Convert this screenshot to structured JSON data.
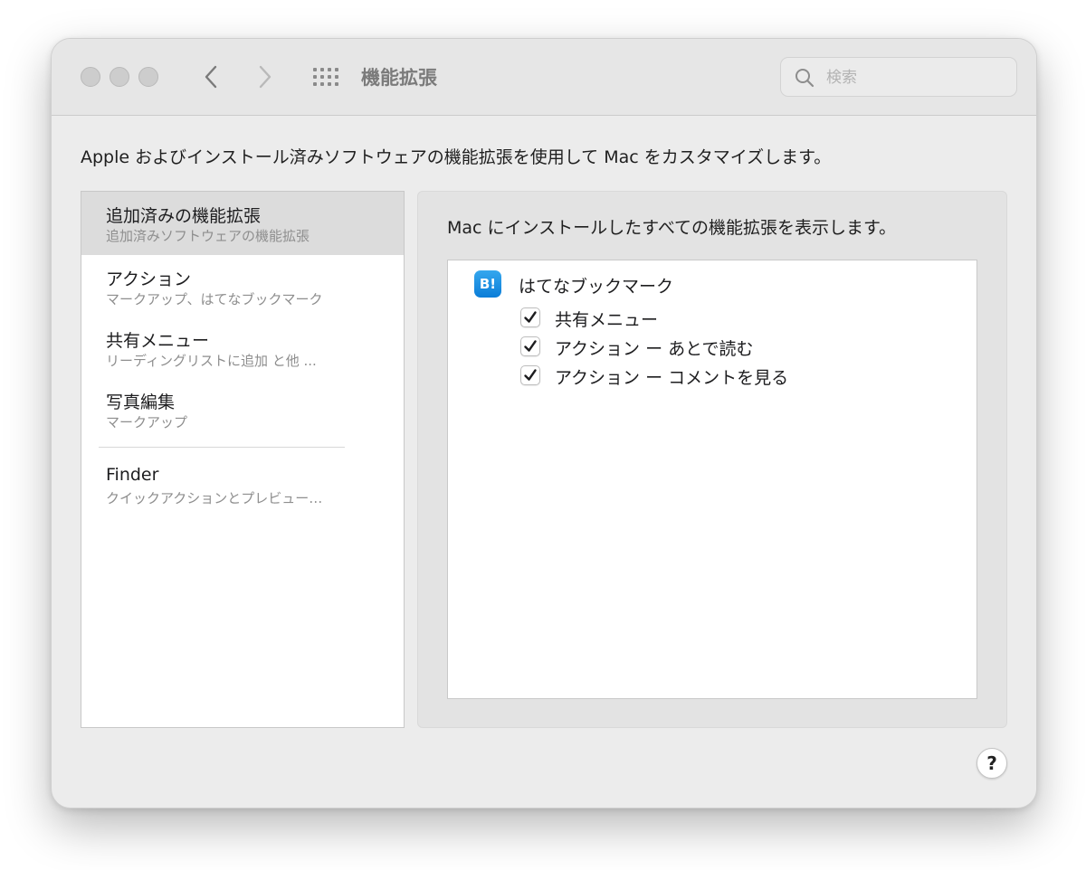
{
  "window": {
    "title": "機能拡張",
    "search_placeholder": "検索",
    "description": "Apple およびインストール済みソフトウェアの機能拡張を使用して Mac をカスタマイズします。"
  },
  "sidebar": {
    "items": [
      {
        "title": "追加済みの機能拡張",
        "subtitle": "追加済みソフトウェアの機能拡張",
        "selected": true
      },
      {
        "title": "アクション",
        "subtitle": "マークアップ、はてなブックマーク",
        "selected": false
      },
      {
        "title": "共有メニュー",
        "subtitle": "リーディングリストに追加 と他 ...",
        "selected": false
      },
      {
        "title": "写真編集",
        "subtitle": "マークアップ",
        "selected": false
      },
      {
        "title": "Finder",
        "subtitle": "クイックアクションとプレビュー…",
        "selected": false
      }
    ]
  },
  "panel": {
    "description": "Mac にインストールしたすべての機能拡張を表示します。",
    "app": {
      "name": "はてなブックマーク",
      "icon_text": "B!",
      "extensions": [
        {
          "label": "共有メニュー",
          "checked": true
        },
        {
          "label": "アクション ー あとで読む",
          "checked": true
        },
        {
          "label": "アクション ー コメントを見る",
          "checked": true
        }
      ]
    }
  },
  "help_label": "?",
  "icons": {
    "back": "chevron-left-icon",
    "forward": "chevron-right-icon",
    "show_all": "grid-icon",
    "search": "search-icon",
    "checkmark": "checkmark-icon"
  },
  "colors": {
    "window_bg": "#ececec",
    "titlebar_bg": "#e6e6e6",
    "selected_row": "#dcdcdc",
    "app_icon": "#1a8fe3"
  }
}
